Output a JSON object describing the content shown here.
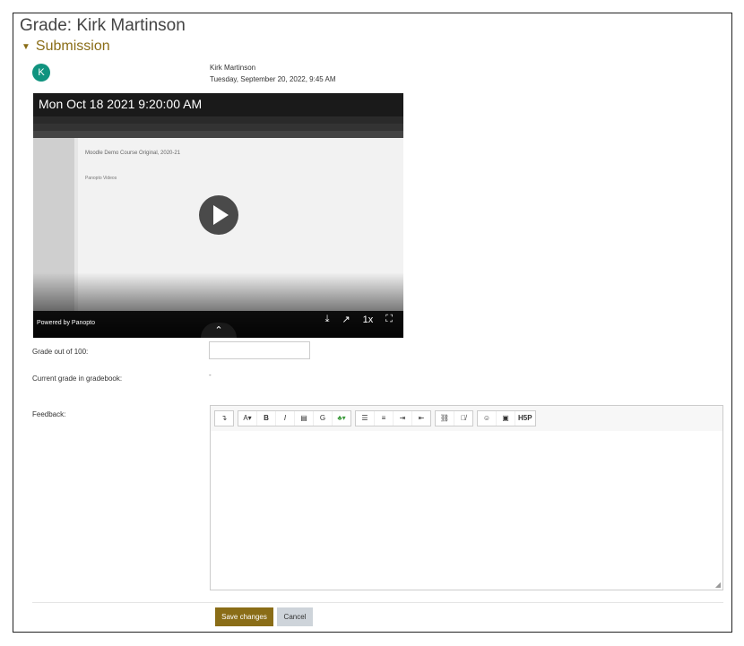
{
  "page": {
    "title": "Grade: Kirk Martinson",
    "section": "Submission"
  },
  "submission": {
    "avatar_letter": "K",
    "name": "Kirk Martinson",
    "date": "Tuesday, September 20, 2022, 9:45 AM"
  },
  "video": {
    "timestamp": "Mon Oct 18 2021 9:20:00 AM",
    "page_heading": "Moodle Demo Course Original, 2020-21",
    "sub_heading": "Panopto Videos",
    "powered_by": "Powered by Panopto",
    "speed": "1x"
  },
  "form": {
    "grade_label": "Grade out of 100:",
    "grade_value": "",
    "current_label": "Current grade in gradebook:",
    "current_value": "-",
    "feedback_label": "Feedback:"
  },
  "toolbar": {
    "groups": [
      [
        "↴"
      ],
      [
        "A▾",
        "B",
        "I",
        "▤",
        "G",
        "♣▾"
      ],
      [
        "☰",
        "≡",
        "⇥",
        "⇤"
      ],
      [
        "⛓",
        "⛓̸"
      ],
      [
        "☺",
        "▣",
        "H5P"
      ]
    ]
  },
  "buttons": {
    "save": "Save changes",
    "cancel": "Cancel"
  },
  "colors": {
    "accent": "#8a6d17",
    "avatar": "#10937f"
  }
}
